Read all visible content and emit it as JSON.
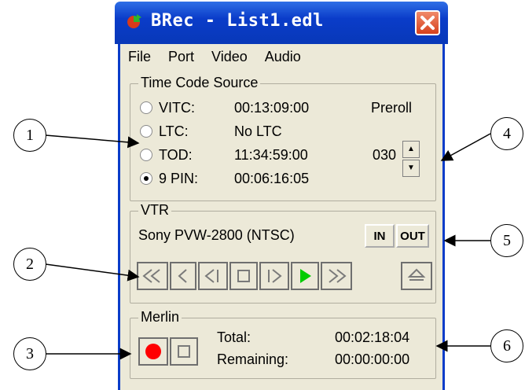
{
  "window": {
    "title": "BRec - List1.edl"
  },
  "menu": [
    "File",
    "Port",
    "Video",
    "Audio"
  ],
  "timecode": {
    "group_label": "Time Code Source",
    "sources": [
      {
        "label": "VITC:",
        "value": "00:13:09:00",
        "selected": false
      },
      {
        "label": "LTC:",
        "value": "No LTC",
        "selected": false
      },
      {
        "label": "TOD:",
        "value": "11:34:59:00",
        "selected": false
      },
      {
        "label": "9 PIN:",
        "value": "00:06:16:05",
        "selected": true
      }
    ],
    "preroll_label": "Preroll",
    "preroll_value": "030"
  },
  "vtr": {
    "group_label": "VTR",
    "device": "Sony PVW-2800 (NTSC)",
    "in_label": "IN",
    "out_label": "OUT",
    "transport": [
      "rewind-icon",
      "step-back-icon",
      "frame-back-icon",
      "stop-icon",
      "frame-forward-icon",
      "play-icon",
      "fast-forward-icon",
      "eject-icon"
    ]
  },
  "merlin": {
    "group_label": "Merlin",
    "total_label": "Total:",
    "total_value": "00:02:18:04",
    "remaining_label": "Remaining:",
    "remaining_value": "00:00:00:00"
  },
  "callouts": [
    "1",
    "2",
    "3",
    "4",
    "5",
    "6"
  ],
  "colors": {
    "titlebar": "#0a3cc9",
    "window_bg": "#ece9d8",
    "record": "#ff0000",
    "play": "#00cc00",
    "close": "#d6401c"
  }
}
